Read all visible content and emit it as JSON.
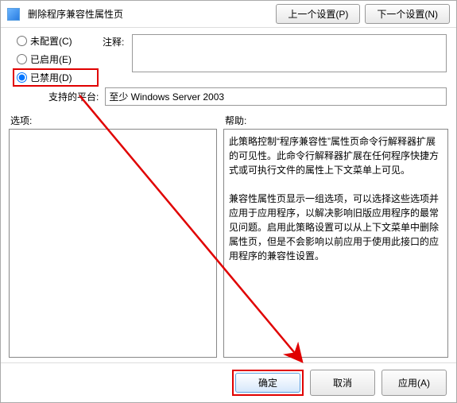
{
  "header": {
    "title": "删除程序兼容性属性页"
  },
  "top_buttons": {
    "prev": "上一个设置(P)",
    "next": "下一个设置(N)"
  },
  "radio": {
    "not_configured": "未配置(C)",
    "enabled": "已启用(E)",
    "disabled": "已禁用(D)"
  },
  "comment": {
    "label": "注释:",
    "value": ""
  },
  "platform": {
    "label": "支持的平台:",
    "value": "至少 Windows Server 2003"
  },
  "sections": {
    "options": "选项:",
    "help": "帮助:"
  },
  "help": {
    "p1": "此策略控制“程序兼容性”属性页命令行解释器扩展的可见性。此命令行解释器扩展在任何程序快捷方式或可执行文件的属性上下文菜单上可见。",
    "p2": "兼容性属性页显示一组选项，可以选择这些选项并应用于应用程序，以解决影响旧版应用程序的最常见问题。启用此策略设置可以从上下文菜单中删除属性页，但是不会影响以前应用于使用此接口的应用程序的兼容性设置。"
  },
  "footer": {
    "ok": "确定",
    "cancel": "取消",
    "apply": "应用(A)"
  }
}
